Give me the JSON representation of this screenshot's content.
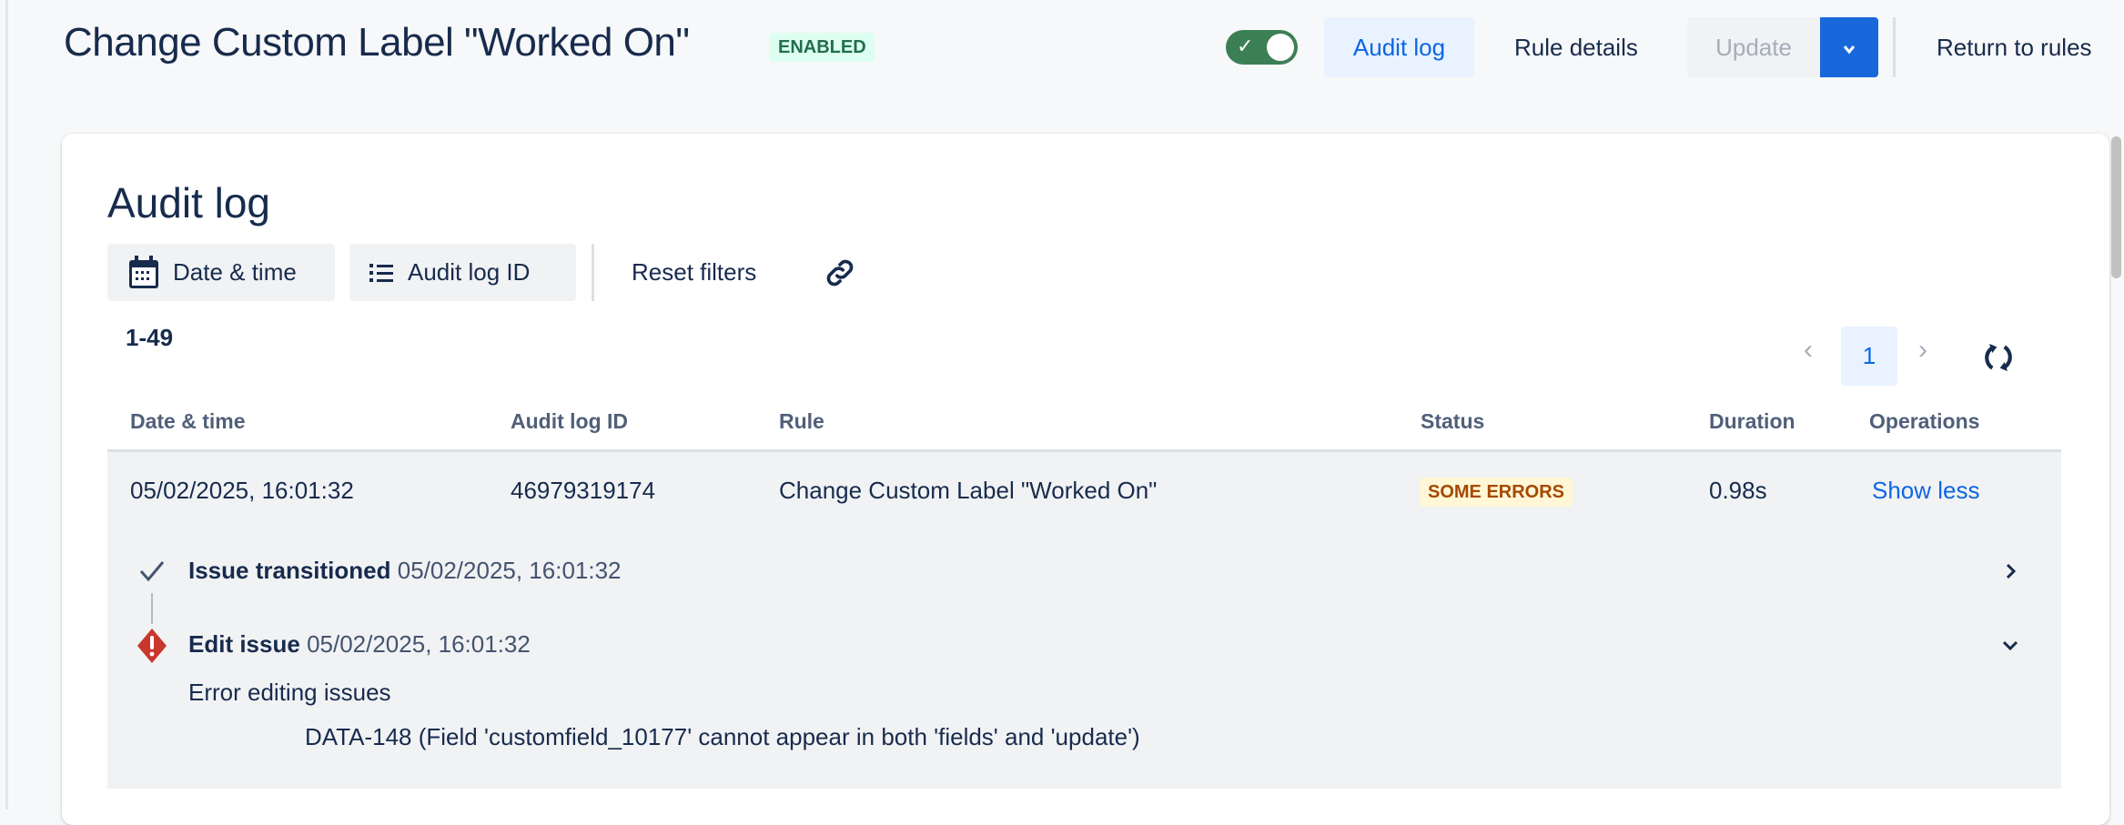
{
  "header": {
    "title": "Change Custom Label \"Worked On\"",
    "status_badge": "ENABLED",
    "toggle_on": true,
    "buttons": {
      "audit_log": "Audit log",
      "rule_details": "Rule details",
      "update": "Update",
      "return": "Return to rules"
    }
  },
  "audit": {
    "heading": "Audit log",
    "filters": {
      "date_time": "Date & time",
      "audit_log_id": "Audit log ID",
      "reset": "Reset filters"
    },
    "count": "1-49",
    "current_page": "1",
    "columns": [
      "Date & time",
      "Audit log ID",
      "Rule",
      "Status",
      "Duration",
      "Operations"
    ],
    "rows": [
      {
        "date": "05/02/2025, 16:01:32",
        "id": "46979319174",
        "rule": "Change Custom Label \"Worked On\"",
        "status": "SOME ERRORS",
        "duration": "0.98s",
        "operation": "Show less",
        "details": [
          {
            "action": "Issue transitioned",
            "time": "05/02/2025, 16:01:32",
            "state": "success"
          },
          {
            "action": "Edit issue",
            "time": "05/02/2025, 16:01:32",
            "state": "error",
            "message": "Error editing issues",
            "detail": "DATA-148 (Field 'customfield_10177' cannot appear in both 'fields' and 'update')"
          }
        ]
      }
    ]
  },
  "colors": {
    "primary": "#0c66e4",
    "success": "#216e4e",
    "warning": "#a54800",
    "danger": "#c9372c"
  }
}
